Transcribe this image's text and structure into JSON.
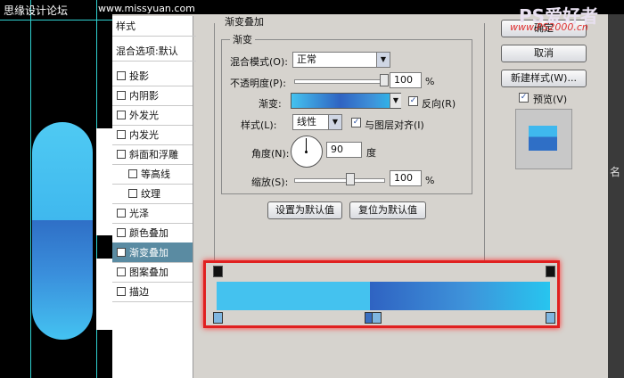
{
  "watermark_left": "思缘设计论坛",
  "watermark_right": {
    "brand": "PS爱好者",
    "url": "www.PS2000.cn"
  },
  "top_url": "www.missyuan.com",
  "sidebar": {
    "title": "样式",
    "blend_options": "混合选项:默认",
    "items": [
      {
        "label": "投影",
        "checked": false,
        "sub": false
      },
      {
        "label": "内阴影",
        "checked": false,
        "sub": false
      },
      {
        "label": "外发光",
        "checked": false,
        "sub": false
      },
      {
        "label": "内发光",
        "checked": false,
        "sub": false
      },
      {
        "label": "斜面和浮雕",
        "checked": false,
        "sub": false
      },
      {
        "label": "等高线",
        "checked": false,
        "sub": true
      },
      {
        "label": "纹理",
        "checked": false,
        "sub": true
      },
      {
        "label": "光泽",
        "checked": false,
        "sub": false
      },
      {
        "label": "颜色叠加",
        "checked": false,
        "sub": false
      },
      {
        "label": "渐变叠加",
        "checked": true,
        "sub": false
      },
      {
        "label": "图案叠加",
        "checked": false,
        "sub": false
      },
      {
        "label": "描边",
        "checked": false,
        "sub": false
      }
    ]
  },
  "panel": {
    "section_title": "渐变叠加",
    "group_title": "渐变",
    "blend_mode_label": "混合模式(O):",
    "blend_mode_value": "正常",
    "opacity_label": "不透明度(P):",
    "opacity_value": "100",
    "opacity_unit": "%",
    "gradient_label": "渐变:",
    "reverse_label": "反向(R)",
    "reverse_checked": true,
    "style_label": "样式(L):",
    "style_value": "线性",
    "align_label": "与图层对齐(I)",
    "align_checked": true,
    "angle_label": "角度(N):",
    "angle_value": "90",
    "angle_unit": "度",
    "scale_label": "缩放(S):",
    "scale_value": "100",
    "scale_unit": "%",
    "make_default": "设置为默认值",
    "reset_default": "复位为默认值"
  },
  "right": {
    "ok": "确定",
    "cancel": "取消",
    "new_style": "新建样式(W)...",
    "preview_label": "预览(V)",
    "preview_checked": true
  },
  "right_edge_text": "名"
}
